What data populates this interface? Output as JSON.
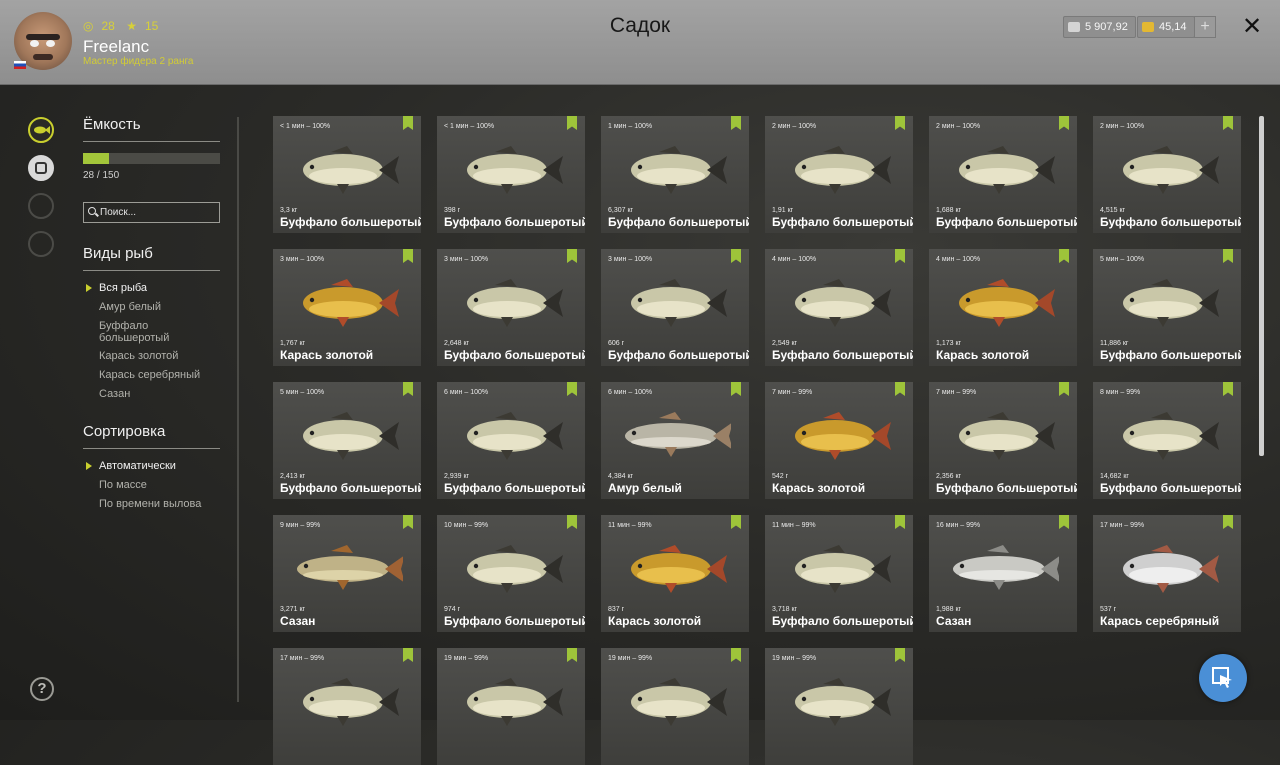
{
  "header": {
    "title": "Садок",
    "player_name": "Freelanc",
    "player_rank": "Мастер фидера 2 ранга",
    "stat_level": "28",
    "stat_stars": "15",
    "silver": "5 907,92",
    "gold": "45,14",
    "plus": "+",
    "close": "✕"
  },
  "sidebar": {
    "capacity_title": "Ёмкость",
    "capacity_text": "28 / 150",
    "capacity_used": 28,
    "capacity_max": 150,
    "search_placeholder": "Поиск...",
    "species_title": "Виды рыб",
    "species": [
      "Вся рыба",
      "Амур белый",
      "Буффало большеротый",
      "Карась золотой",
      "Карась серебряный",
      "Сазан"
    ],
    "species_selected": "Вся рыба",
    "sort_title": "Сортировка",
    "sort_options": [
      "Автоматически",
      "По массе",
      "По времени вылова"
    ],
    "sort_selected": "Автоматически"
  },
  "colors": {
    "accent": "#c9cf2e",
    "capacity_fill": "#a3c63a",
    "checked_flag": "#9ec43a",
    "fab": "#4a8fd6"
  },
  "fish": [
    {
      "time": "< 1 мин – 100%",
      "weight": "3,3 кг",
      "name": "Буффало большеротый",
      "kind": "buffalo"
    },
    {
      "time": "< 1 мин – 100%",
      "weight": "398 г",
      "name": "Буффало большеротый",
      "kind": "buffalo"
    },
    {
      "time": "1 мин – 100%",
      "weight": "6,307 кг",
      "name": "Буффало большеротый",
      "kind": "buffalo"
    },
    {
      "time": "2 мин – 100%",
      "weight": "1,91 кг",
      "name": "Буффало большеротый",
      "kind": "buffalo"
    },
    {
      "time": "2 мин – 100%",
      "weight": "1,688 кг",
      "name": "Буффало большеротый",
      "kind": "buffalo"
    },
    {
      "time": "2 мин – 100%",
      "weight": "4,515 кг",
      "name": "Буффало большеротый",
      "kind": "buffalo"
    },
    {
      "time": "3 мин – 100%",
      "weight": "1,767 кг",
      "name": "Карась золотой",
      "kind": "gold"
    },
    {
      "time": "3 мин – 100%",
      "weight": "2,648 кг",
      "name": "Буффало большеротый",
      "kind": "buffalo"
    },
    {
      "time": "3 мин – 100%",
      "weight": "606 г",
      "name": "Буффало большеротый",
      "kind": "buffalo"
    },
    {
      "time": "4 мин – 100%",
      "weight": "2,549 кг",
      "name": "Буффало большеротый",
      "kind": "buffalo"
    },
    {
      "time": "4 мин – 100%",
      "weight": "1,173 кг",
      "name": "Карась золотой",
      "kind": "gold"
    },
    {
      "time": "5 мин – 100%",
      "weight": "11,886 кг",
      "name": "Буффало большеротый",
      "kind": "buffalo"
    },
    {
      "time": "5 мин – 100%",
      "weight": "2,413 кг",
      "name": "Буффало большеротый",
      "kind": "buffalo"
    },
    {
      "time": "6 мин – 100%",
      "weight": "2,939 кг",
      "name": "Буффало большеротый",
      "kind": "buffalo"
    },
    {
      "time": "6 мин – 100%",
      "weight": "4,384 кг",
      "name": "Амур белый",
      "kind": "amur"
    },
    {
      "time": "7 мин – 99%",
      "weight": "542 г",
      "name": "Карась золотой",
      "kind": "gold"
    },
    {
      "time": "7 мин – 99%",
      "weight": "2,356 кг",
      "name": "Буффало большеротый",
      "kind": "buffalo"
    },
    {
      "time": "8 мин – 99%",
      "weight": "14,682 кг",
      "name": "Буффало большеротый",
      "kind": "buffalo"
    },
    {
      "time": "9 мин – 99%",
      "weight": "3,271 кг",
      "name": "Сазан",
      "kind": "carp"
    },
    {
      "time": "10 мин – 99%",
      "weight": "974 г",
      "name": "Буффало большеротый",
      "kind": "buffalo"
    },
    {
      "time": "11 мин – 99%",
      "weight": "837 г",
      "name": "Карась золотой",
      "kind": "gold"
    },
    {
      "time": "11 мин – 99%",
      "weight": "3,718 кг",
      "name": "Буффало большеротый",
      "kind": "buffalo"
    },
    {
      "time": "16 мин – 99%",
      "weight": "1,988 кг",
      "name": "Сазан",
      "kind": "carp2"
    },
    {
      "time": "17 мин – 99%",
      "weight": "537 г",
      "name": "Карась серебряный",
      "kind": "silver"
    },
    {
      "time": "17 мин – 99%",
      "weight": "",
      "name": "",
      "kind": "buffalo"
    },
    {
      "time": "19 мин – 99%",
      "weight": "",
      "name": "",
      "kind": "buffalo"
    },
    {
      "time": "19 мин – 99%",
      "weight": "",
      "name": "",
      "kind": "buffalo"
    },
    {
      "time": "19 мин – 99%",
      "weight": "",
      "name": "",
      "kind": "buffalo"
    }
  ]
}
